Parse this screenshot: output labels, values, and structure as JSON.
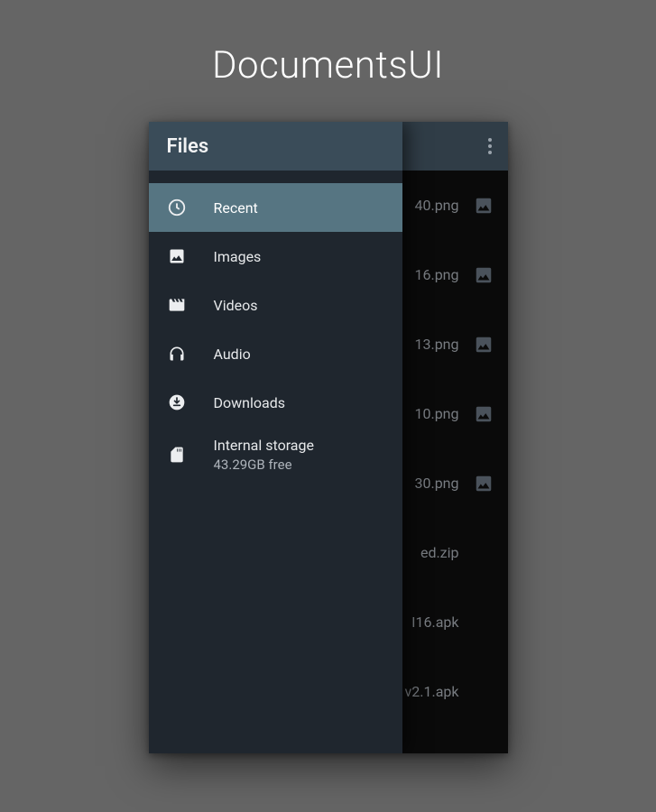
{
  "page_title": "DocumentsUI",
  "header": {
    "title": "Files"
  },
  "sidebar": {
    "items": [
      {
        "label": "Recent",
        "icon": "clock-icon",
        "active": true
      },
      {
        "label": "Images",
        "icon": "image-icon",
        "active": false
      },
      {
        "label": "Videos",
        "icon": "video-icon",
        "active": false
      },
      {
        "label": "Audio",
        "icon": "audio-icon",
        "active": false
      },
      {
        "label": "Downloads",
        "icon": "download-icon",
        "active": false
      },
      {
        "label": "Internal storage",
        "sublabel": "43.29GB free",
        "icon": "sdcard-icon",
        "active": false
      }
    ]
  },
  "files": [
    {
      "name": "40.png",
      "type": "image"
    },
    {
      "name": "16.png",
      "type": "image"
    },
    {
      "name": "13.png",
      "type": "image"
    },
    {
      "name": "10.png",
      "type": "image"
    },
    {
      "name": "30.png",
      "type": "image"
    },
    {
      "name": "ed.zip",
      "type": "archive"
    },
    {
      "name": "I16.apk",
      "type": "apk"
    },
    {
      "name": "v2.1.apk",
      "type": "apk"
    }
  ],
  "colors": {
    "background": "#656565",
    "drawer_bg": "#1f262e",
    "drawer_header": "#3a4c59",
    "drawer_active": "#567582",
    "filelist_bg": "#0a0a0a",
    "filelist_header": "#303d47"
  }
}
